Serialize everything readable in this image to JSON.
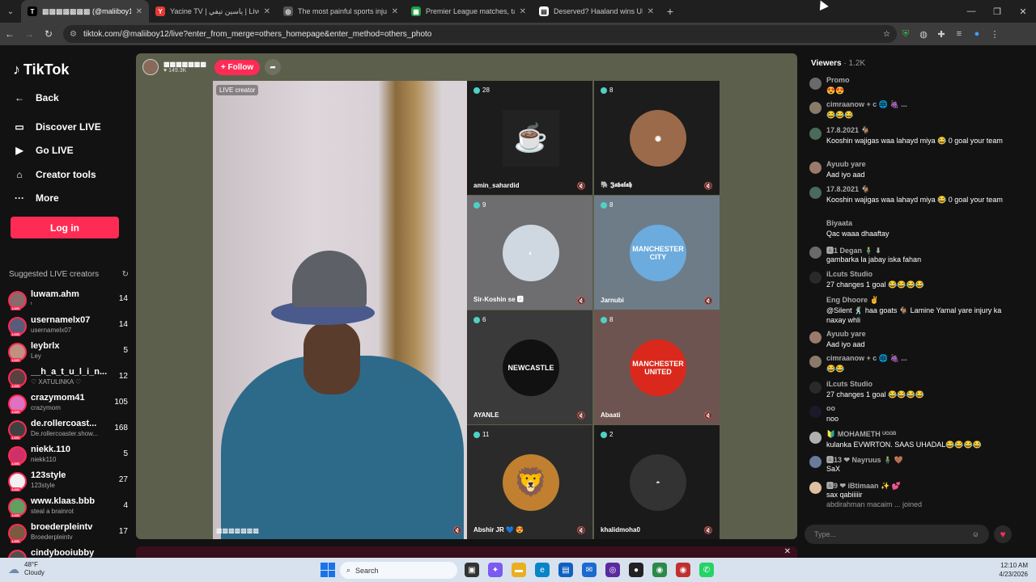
{
  "browser": {
    "tabs": [
      {
        "title": "▩▩▩▩▩▩▩ (@maliiboy1",
        "favicon": "T",
        "fav_color": "#000000",
        "active": true
      },
      {
        "title": "Yacine TV | ياسين تيفي | Live Str",
        "favicon": "Y",
        "fav_color": "#e53935",
        "active": false
      },
      {
        "title": "The most painful sports injuries",
        "favicon": "◎",
        "fav_color": "#555555",
        "active": false
      },
      {
        "title": "Premier League matches, tables",
        "favicon": "▦",
        "fav_color": "#1e9e4a",
        "active": false
      },
      {
        "title": "Deserved? Haaland wins UEFA P",
        "favicon": "▤",
        "fav_color": "#ffffff",
        "active": false
      }
    ],
    "url": "tiktok.com/@maliiboy12/live?enter_from_merge=others_homepage&enter_method=others_photo"
  },
  "sidebar": {
    "brand": "TikTok",
    "back_label": "Back",
    "nav": [
      {
        "label": "Discover LIVE",
        "icon": "discover-live-icon"
      },
      {
        "label": "Go LIVE",
        "icon": "go-live-icon"
      },
      {
        "label": "Creator tools",
        "icon": "creator-tools-icon"
      },
      {
        "label": "More",
        "icon": "more-icon"
      }
    ],
    "login_label": "Log in",
    "suggested_title": "Suggested LIVE creators",
    "creators": [
      {
        "name": "luwam.ahm",
        "sub": "ᵗ",
        "count": "14",
        "color": "#8a6a6a"
      },
      {
        "name": "usernamelx07",
        "sub": "usernamelx07",
        "count": "14",
        "color": "#5a5a7a"
      },
      {
        "name": "leybrlx",
        "sub": "Ley",
        "count": "5",
        "color": "#c09080"
      },
      {
        "name": "__h_a_t_u_l_i_n...",
        "sub": "♡ XATULINKA ♡",
        "count": "12",
        "color": "#5a4040"
      },
      {
        "name": "crazymom41",
        "sub": "crazymom",
        "count": "105",
        "color": "#e070c0"
      },
      {
        "name": "de.rollercoast...",
        "sub": "De.rollercoaster.show...",
        "count": "168",
        "color": "#404040"
      },
      {
        "name": "niekk.110",
        "sub": "niekk110",
        "count": "5",
        "color": "#d0306a"
      },
      {
        "name": "123style",
        "sub": "123style",
        "count": "27",
        "color": "#f0f0f0"
      },
      {
        "name": "www.klaas.bbb",
        "sub": "steal a brainrot",
        "count": "4",
        "color": "#60a060"
      },
      {
        "name": "broederpleintv",
        "sub": "Broederpleintv",
        "count": "17",
        "color": "#7a5a40"
      },
      {
        "name": "cindybooiubby",
        "sub": "",
        "count": "",
        "color": "#505050"
      }
    ]
  },
  "live": {
    "host_name": "▩▩▩▩▩▩▩",
    "host_likes": "♥ 149.3K",
    "follow_label": "+ Follow",
    "live_creator_label": "LIVE creator",
    "host_footer": "▩▩▩▩▩▩▩",
    "guests": [
      {
        "count": "28",
        "name": "amin_sahardid",
        "pic": "☕",
        "pic_color": "#222222",
        "bg": "#1c1c1c"
      },
      {
        "count": "8",
        "name": "🐘 𝕵𝖆𝖇𝖆𝖑𝖆𝖍",
        "pic": "◉",
        "pic_color": "#9a6a4a",
        "bg": "#1c1c1c"
      },
      {
        "count": "9",
        "name": "Sir-Koshin se 🅰",
        "pic": "◐",
        "pic_color": "#cfd8e0",
        "bg": "#6e6e70"
      },
      {
        "count": "8",
        "name": "Jarnubi",
        "pic": "MANCHESTER CITY",
        "pic_color": "#6cabdd",
        "bg": "#6e7c88"
      },
      {
        "count": "6",
        "name": "AYANLE",
        "pic": "NEWCASTLE",
        "pic_color": "#111111",
        "bg": "#3a3a3a"
      },
      {
        "count": "8",
        "name": "Abaati",
        "pic": "MANCHESTER UNITED",
        "pic_color": "#da291c",
        "bg": "#6e5450"
      },
      {
        "count": "11",
        "name": "Abshir JR 💙 😍",
        "pic": "🦁",
        "pic_color": "#c08030",
        "bg": "#2a2a2a"
      },
      {
        "count": "2",
        "name": "khalidmoha0",
        "pic": "◓",
        "pic_color": "#333333",
        "bg": "#1a1a1a"
      }
    ]
  },
  "chat": {
    "viewers_label": "Viewers",
    "viewers_count": "· 1.2K",
    "messages": [
      {
        "user": "Promo",
        "text": "😍😍",
        "color": "#6a6a6a"
      },
      {
        "user": "cimraanow + c 🌐 🍇 ...",
        "text": "😂😂😂",
        "color": "#8a7a6a"
      },
      {
        "user": "17.8.2021 🐐",
        "text": "Kooshin wajigas waa lahayd miya 😂 0 goal your team",
        "color": "#4a6a5a"
      },
      {
        "user": "Ayuub yare",
        "text": "Aad iyo aad",
        "color": "#9a7a6a"
      },
      {
        "user": "17.8.2021 🐐",
        "text": "Kooshin wajigas waa lahayd miya 😂 0 goal your team",
        "color": "#4a6a5a"
      },
      {
        "user": "Biyaata",
        "text": "Qac waaa dhaaftay",
        "color": "#121212"
      },
      {
        "user": "🅰1 Degan 🧍‍♂️ ⬇",
        "text": "gambarka la jabay iska fahan",
        "color": "#6a6a6a"
      },
      {
        "user": "iLcuts Studio",
        "text": "27 changes 1 goal 😂😂😂😂",
        "color": "#2a2a2a"
      },
      {
        "user": "Eng Dhoore ✌",
        "text": "@Silent 🕺 haa goats 🐐 Lamine Yamal yare injury ka naxay whli",
        "color": "#121212"
      },
      {
        "user": "Ayuub yare",
        "text": "Aad iyo aad",
        "color": "#9a7a6a"
      },
      {
        "user": "cimraanow + c 🌐 🍇 ...",
        "text": "😂😂",
        "color": "#8a7a6a"
      },
      {
        "user": "iLcuts Studio",
        "text": "27 changes 1 goal 😂😂😂😂",
        "color": "#2a2a2a"
      },
      {
        "user": "oo",
        "text": "noo",
        "color": "#1a1a2a"
      },
      {
        "user": "🔰 MOHAMETH ᵁᴳᴳᴮ",
        "text": "kulanka EVWRTON. SAAS UHADAL😂😂😂😂",
        "color": "#b0b0b0"
      },
      {
        "user": "🅰13 ❤ Nayruus 🧍‍♂️ 🤎",
        "text": "SaX",
        "color": "#6a7a9a"
      },
      {
        "user": "🅰9 ❤ iBtimaan ✨ 💕",
        "text": "sax qabiiiiir",
        "color": "#e0c0a0"
      }
    ],
    "joined_text": "abdirahman macaim ... joined",
    "input_placeholder": "Type..."
  },
  "taskbar": {
    "temp": "48°F",
    "weather": "Cloudy",
    "search_label": "Search",
    "time": "12:10 AM",
    "date": "4/23/2026"
  }
}
